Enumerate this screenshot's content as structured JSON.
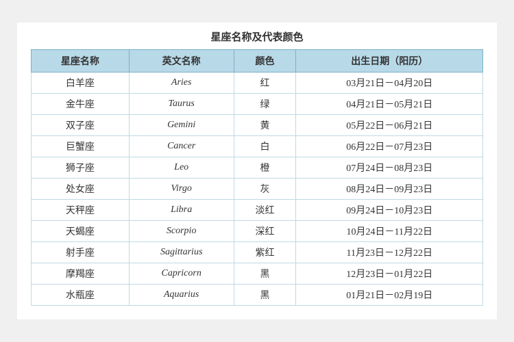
{
  "title": "星座名称及代表颜色",
  "headers": [
    "星座名称",
    "英文名称",
    "颜色",
    "出生日期（阳历）"
  ],
  "rows": [
    {
      "chinese": "白羊座",
      "english": "Aries",
      "color": "红",
      "date": "03月21日－04月20日"
    },
    {
      "chinese": "金牛座",
      "english": "Taurus",
      "color": "绿",
      "date": "04月21日－05月21日"
    },
    {
      "chinese": "双子座",
      "english": "Gemini",
      "color": "黄",
      "date": "05月22日－06月21日"
    },
    {
      "chinese": "巨蟹座",
      "english": "Cancer",
      "color": "白",
      "date": "06月22日－07月23日"
    },
    {
      "chinese": "狮子座",
      "english": "Leo",
      "color": "橙",
      "date": "07月24日－08月23日"
    },
    {
      "chinese": "处女座",
      "english": "Virgo",
      "color": "灰",
      "date": "08月24日－09月23日"
    },
    {
      "chinese": "天秤座",
      "english": "Libra",
      "color": "淡红",
      "date": "09月24日－10月23日"
    },
    {
      "chinese": "天蝎座",
      "english": "Scorpio",
      "color": "深红",
      "date": "10月24日－11月22日"
    },
    {
      "chinese": "射手座",
      "english": "Sagittarius",
      "color": "紫红",
      "date": "11月23日－12月22日"
    },
    {
      "chinese": "摩羯座",
      "english": "Capricorn",
      "color": "黑",
      "date": "12月23日－01月22日"
    },
    {
      "chinese": "水瓶座",
      "english": "Aquarius",
      "color": "黑",
      "date": "01月21日－02月19日"
    }
  ]
}
